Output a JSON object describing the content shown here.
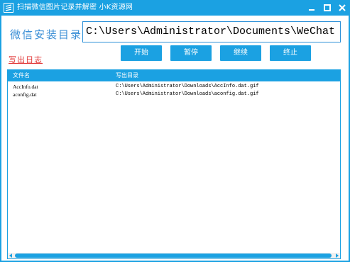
{
  "window": {
    "title": "扫描微信图片记录并解密  小K资源网",
    "accent_color": "#1ba1e2",
    "controls": [
      "minimize-icon",
      "maximize-icon",
      "close-icon"
    ]
  },
  "form": {
    "directory_label": "微信安装目录",
    "directory_value": "C:\\Users\\Administrator\\Documents\\WeChat Files\\",
    "log_link": "写出日志"
  },
  "buttons": {
    "start": "开始",
    "pause": "暂停",
    "continue": "继续",
    "stop": "终止"
  },
  "table": {
    "columns": [
      "文件名",
      "写出目录"
    ],
    "rows": [
      [
        "AccInfo.dat",
        "C:\\Users\\Administrator\\Downloads\\AccInfo.dat.gif"
      ],
      [
        "aconfig.dat",
        "C:\\Users\\Administrator\\Downloads\\aconfig.dat.gif"
      ]
    ]
  }
}
